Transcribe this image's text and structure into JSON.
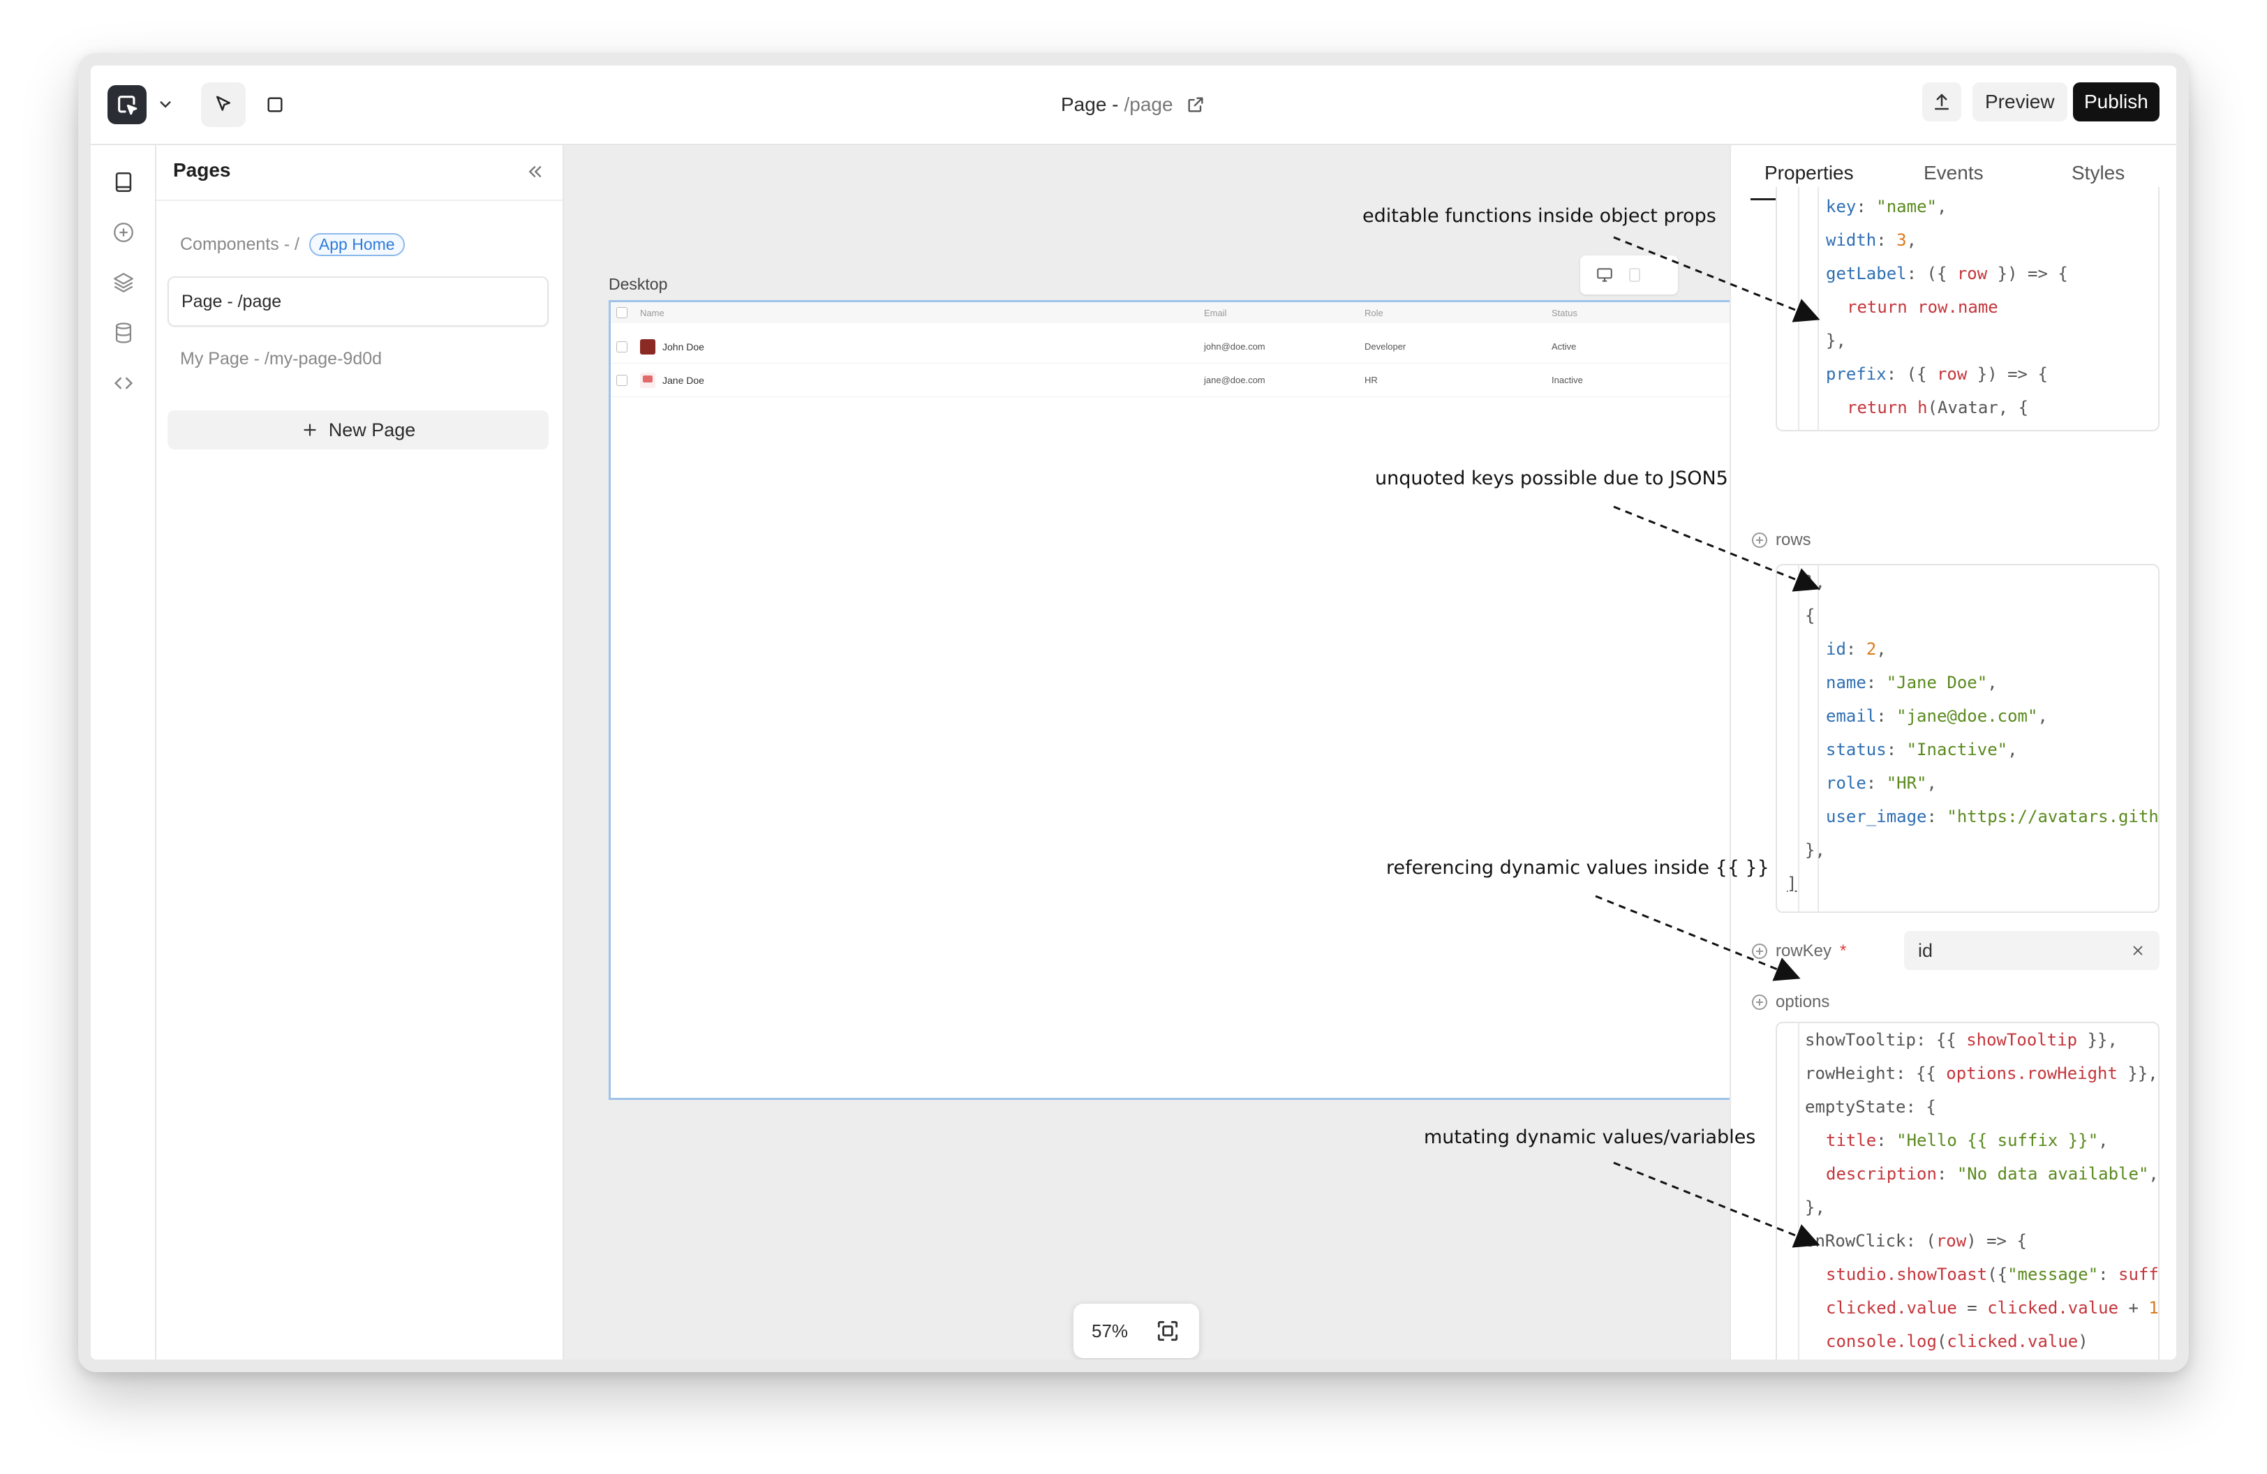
{
  "topbar": {
    "page_title": "Page -",
    "page_path": "/page",
    "preview_label": "Preview",
    "publish_label": "Publish"
  },
  "pages_panel": {
    "title": "Pages",
    "items": [
      {
        "label": "Components - /",
        "badge": "App Home"
      },
      {
        "label": "Page - /page"
      },
      {
        "label": "My Page - /my-page-9d0d"
      }
    ],
    "new_page_label": "New Page"
  },
  "canvas": {
    "device_label": "Desktop",
    "zoom": "57%",
    "table": {
      "columns": [
        "Name",
        "Email",
        "Role",
        "Status"
      ],
      "rows": [
        {
          "name": "John Doe",
          "email": "john@doe.com",
          "role": "Developer",
          "status": "Active"
        },
        {
          "name": "Jane Doe",
          "email": "jane@doe.com",
          "role": "HR",
          "status": "Inactive"
        }
      ]
    }
  },
  "properties": {
    "tabs": [
      "Properties",
      "Events",
      "Styles"
    ],
    "rows_label": "rows",
    "rowkey_label": "rowKey",
    "rowkey_required": "*",
    "rowkey_value": "id",
    "options_label": "options"
  },
  "annotations": {
    "a1": "editable functions inside object props",
    "a2": "unquoted keys possible due to JSON5",
    "a3": "referencing dynamic values inside {{ }}",
    "a4": "mutating dynamic values/variables"
  },
  "colors": {
    "accent": "#2f7bd8",
    "publish_bg": "#111111",
    "canvas_bg": "#ededed",
    "frame_border": "#9ec3ea",
    "code_key": "#2f6fb3",
    "code_string": "#5a8a1e",
    "code_number": "#d97a1e",
    "code_var": "#c4363c"
  }
}
